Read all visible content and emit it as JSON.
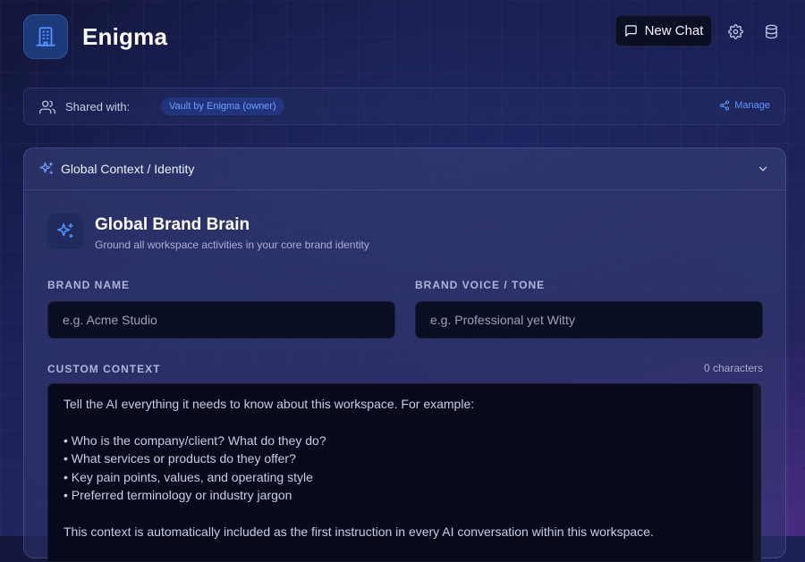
{
  "header": {
    "app_title": "Enigma",
    "new_chat_label": "New Chat",
    "icons": [
      "building-icon",
      "chat-icon",
      "gear-icon",
      "database-icon"
    ]
  },
  "shared": {
    "label": "Shared with:",
    "owner_badge": "Vault by Enigma (owner)",
    "manage_label": "Manage"
  },
  "panel": {
    "header_title": "Global Context / Identity",
    "brain_title": "Global Brand Brain",
    "brain_subtitle": "Ground all workspace activities in your core brand identity",
    "brand_name": {
      "label": "BRAND NAME",
      "placeholder": "e.g. Acme Studio",
      "value": ""
    },
    "brand_voice": {
      "label": "BRAND VOICE / TONE",
      "placeholder": "e.g. Professional yet Witty",
      "value": ""
    },
    "custom_context": {
      "label": "CUSTOM CONTEXT",
      "char_count": "0 characters",
      "placeholder_lines": [
        "Tell the AI everything it needs to know about this workspace. For example:",
        "",
        "• Who is the company/client? What do they do?",
        "• What services or products do they offer?",
        "• Key pain points, values, and operating style",
        "• Preferred terminology or industry jargon",
        "",
        "This context is automatically included as the first instruction in every AI conversation within this workspace."
      ]
    }
  },
  "colors": {
    "accent": "#5f96ff",
    "logo_bg": "#1d3a78",
    "input_bg": "#0a0e22",
    "button_bg": "#0b0f24"
  }
}
